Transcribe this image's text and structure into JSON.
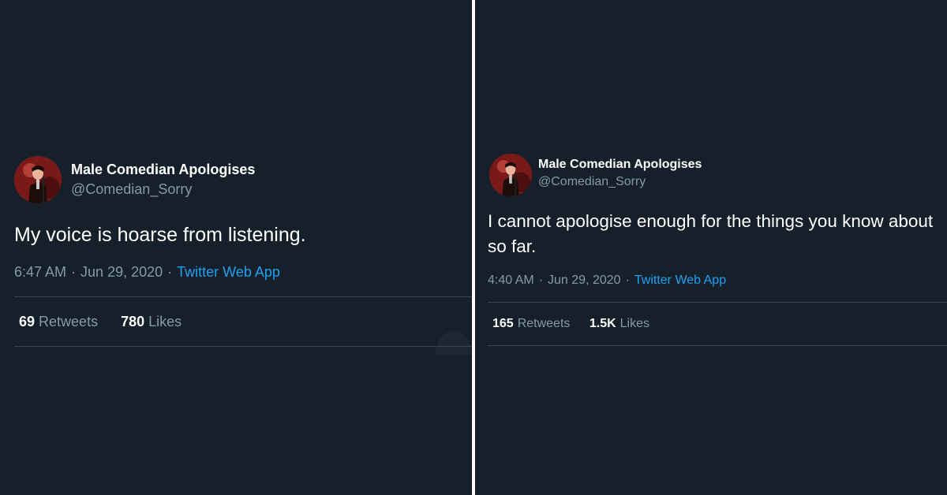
{
  "tweets": [
    {
      "display_name": "Male Comedian Apologises",
      "handle": "@Comedian_Sorry",
      "text": "My voice is hoarse from listening.",
      "time": "6:47 AM",
      "date": "Jun 29, 2020",
      "separator": "·",
      "source": "Twitter Web App",
      "retweets_count": "69",
      "retweets_label": "Retweets",
      "likes_count": "780",
      "likes_label": "Likes"
    },
    {
      "display_name": "Male Comedian Apologises",
      "handle": "@Comedian_Sorry",
      "text": "I cannot apologise enough for the things you know about so far.",
      "time": "4:40 AM",
      "date": "Jun 29, 2020",
      "separator": "·",
      "source": "Twitter Web App",
      "retweets_count": "165",
      "retweets_label": "Retweets",
      "likes_count": "1.5K",
      "likes_label": "Likes"
    }
  ],
  "colors": {
    "background": "#16202b",
    "text_primary": "#ffffff",
    "text_secondary": "#8899a6",
    "link": "#1da1f2",
    "divider": "#38444d",
    "panel_gap": "#ffffff"
  },
  "icons": {
    "avatar": "profile-photo-avatar"
  }
}
